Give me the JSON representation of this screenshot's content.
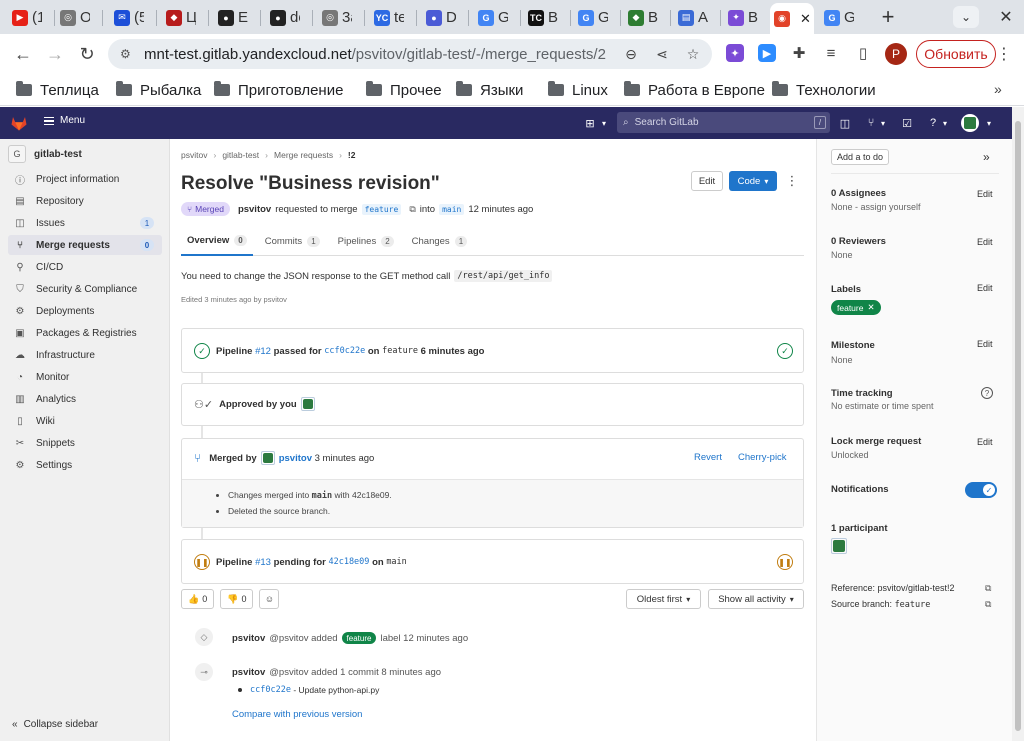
{
  "browser": {
    "tabs": [
      {
        "title": "(1",
        "color": "#e62117",
        "glyph": "▶"
      },
      {
        "title": "O",
        "color": "#777777",
        "glyph": "◎"
      },
      {
        "title": "(5",
        "color": "#1d4fd8",
        "glyph": "✉"
      },
      {
        "title": "Ц",
        "color": "#b71c1c",
        "glyph": "◆"
      },
      {
        "title": "E",
        "color": "#222222",
        "glyph": "●"
      },
      {
        "title": "de",
        "color": "#222222",
        "glyph": "●"
      },
      {
        "title": "3a",
        "color": "#777777",
        "glyph": "◎"
      },
      {
        "title": "te",
        "color": "#2d6ae3",
        "glyph": "YC"
      },
      {
        "title": "D",
        "color": "#4b5bd6",
        "glyph": "●"
      },
      {
        "title": "G",
        "color": "#4285f4",
        "glyph": "G"
      },
      {
        "title": "B",
        "color": "#111111",
        "glyph": "TC"
      },
      {
        "title": "G",
        "color": "#4285f4",
        "glyph": "G"
      },
      {
        "title": "B",
        "color": "#2e7d32",
        "glyph": "◆"
      },
      {
        "title": "A",
        "color": "#3b6bd6",
        "glyph": "▤"
      },
      {
        "title": "B",
        "color": "#7b4bd6",
        "glyph": "✦"
      },
      {
        "title": "",
        "color": "#e24329",
        "glyph": "◉"
      },
      {
        "title": "G",
        "color": "#4285f4",
        "glyph": "G"
      }
    ],
    "url_host": "mnt-test.gitlab.yandexcloud.net",
    "url_path": "/psvitov/gitlab-test/-/merge_requests/2",
    "update_label": "Обновить",
    "profile_letter": "P",
    "bookmarks": [
      "Теплица",
      "Рыбалка",
      "Приготовление",
      "Прочее",
      "Языки",
      "Linux",
      "Работа в Европе",
      "Технологии"
    ]
  },
  "header": {
    "menu_label": "Menu",
    "search_placeholder": "Search GitLab",
    "search_shortcut": "/"
  },
  "sidebar": {
    "project_letter": "G",
    "project_name": "gitlab-test",
    "items": [
      {
        "label": "Project information",
        "icon": "info-icon",
        "glyph": "ⓘ"
      },
      {
        "label": "Repository",
        "icon": "doc-icon",
        "glyph": "▤"
      },
      {
        "label": "Issues",
        "icon": "issues-icon",
        "glyph": "◫",
        "count": "1"
      },
      {
        "label": "Merge requests",
        "icon": "merge-icon",
        "glyph": "⑂",
        "count": "0",
        "active": true
      },
      {
        "label": "CI/CD",
        "icon": "rocket-icon",
        "glyph": "⚲"
      },
      {
        "label": "Security & Compliance",
        "icon": "shield-icon",
        "glyph": "⛉"
      },
      {
        "label": "Deployments",
        "icon": "deploy-icon",
        "glyph": "⚙"
      },
      {
        "label": "Packages & Registries",
        "icon": "package-icon",
        "glyph": "▣"
      },
      {
        "label": "Infrastructure",
        "icon": "cloud-icon",
        "glyph": "☁"
      },
      {
        "label": "Monitor",
        "icon": "monitor-icon",
        "glyph": "◔"
      },
      {
        "label": "Analytics",
        "icon": "chart-icon",
        "glyph": "▥"
      },
      {
        "label": "Wiki",
        "icon": "book-icon",
        "glyph": "▯"
      },
      {
        "label": "Snippets",
        "icon": "scissors-icon",
        "glyph": "✂"
      },
      {
        "label": "Settings",
        "icon": "settings-icon",
        "glyph": "⚙"
      }
    ],
    "collapse_label": "Collapse sidebar"
  },
  "mr": {
    "breadcrumbs": [
      "psvitov",
      "gitlab-test",
      "Merge requests",
      "!2"
    ],
    "title": "Resolve \"Business revision\"",
    "edit_label": "Edit",
    "code_label": "Code",
    "status": "Merged",
    "author": "psvitov",
    "requested_text": "requested to merge",
    "source_branch": "feature",
    "into_text": "into",
    "target_branch": "main",
    "time_ago": "12 minutes ago",
    "tabs": [
      {
        "label": "Overview",
        "count": "0"
      },
      {
        "label": "Commits",
        "count": "1"
      },
      {
        "label": "Pipelines",
        "count": "2"
      },
      {
        "label": "Changes",
        "count": "1"
      }
    ],
    "description": "You need to change the JSON response to the GET method call",
    "description_code": "/rest/api/get_info",
    "edited_text": "Edited 3 minutes ago by psvitov",
    "pipeline1": {
      "label": "Pipeline",
      "id": "#12",
      "status": "passed for",
      "sha": "ccf0c22e",
      "on": "on",
      "branch": "feature",
      "time": "6 minutes ago"
    },
    "approved_text": "Approved by you",
    "merged": {
      "label": "Merged by",
      "user": "psvitov",
      "time": "3 minutes ago",
      "revert": "Revert",
      "cherry": "Cherry-pick",
      "line1_pre": "Changes merged into",
      "line1_branch": "main",
      "line1_with": "with",
      "line1_sha": "42c18e09.",
      "line2": "Deleted the source branch."
    },
    "pipeline2": {
      "label": "Pipeline",
      "id": "#13",
      "status": "pending for",
      "sha": "42c18e09",
      "on": "on",
      "branch": "main"
    },
    "reactions": {
      "thumbs_up": "0",
      "thumbs_down": "0"
    },
    "sort_label": "Oldest first",
    "activity_label": "Show all activity",
    "notes": {
      "note1_user": "psvitov",
      "note1_handle": "@psvitov added",
      "note1_label": "feature",
      "note1_rest": "label 12 minutes ago",
      "note2_user": "psvitov",
      "note2_rest": "@psvitov added 1 commit 8 minutes ago",
      "commit_sha": "ccf0c22e",
      "commit_msg": "- Update python-api.py",
      "compare": "Compare with previous version"
    }
  },
  "right": {
    "todo": "Add a to do",
    "assignees_title": "0 Assignees",
    "assignees_val": "None - assign yourself",
    "reviewers_title": "0 Reviewers",
    "reviewers_val": "None",
    "labels_title": "Labels",
    "label_chip": "feature",
    "milestone_title": "Milestone",
    "milestone_val": "None",
    "time_title": "Time tracking",
    "time_val": "No estimate or time spent",
    "lock_title": "Lock merge request",
    "lock_val": "Unlocked",
    "notif_title": "Notifications",
    "participants": "1 participant",
    "reference": "Reference: psvitov/gitlab-test!2",
    "source_label": "Source branch:",
    "source_branch": "feature",
    "edit": "Edit"
  }
}
